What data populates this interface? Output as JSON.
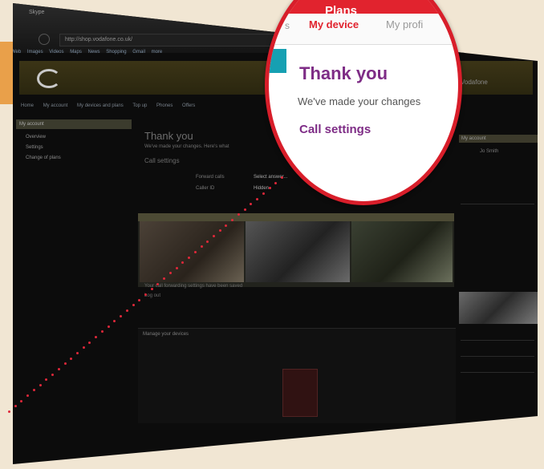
{
  "browser": {
    "title": "Skype",
    "url": "http://shop.vodafone.co.uk/",
    "menu": [
      "Web",
      "Images",
      "Videos",
      "Maps",
      "News",
      "Shopping",
      "Gmail",
      "more"
    ]
  },
  "site": {
    "header_right": "Vodafone",
    "subnav": [
      "Home",
      "My account",
      "My devices and plans",
      "Top up",
      "Phones",
      "Offers"
    ]
  },
  "sidebar": {
    "title": "My account",
    "items": [
      "Overview",
      "Settings",
      "Change of plans"
    ]
  },
  "main": {
    "title": "Thank you",
    "subtitle": "We've made your changes. Here's what",
    "section": "Call settings",
    "rows": [
      {
        "label": "Forward calls",
        "value": "Select answer..."
      },
      {
        "label": "Caller ID",
        "value": "Hidden"
      }
    ],
    "caption": "Your call forwarding settings have been saved",
    "link": "Log out",
    "panel_title": "Manage your devices"
  },
  "rightcol": {
    "title": "My account",
    "username": "Jo Smith"
  },
  "magnifier": {
    "tab_plans": "Plans",
    "tab_partial": "s",
    "tab_my_device": "My device",
    "tab_my_profile": "My profi",
    "title": "Thank you",
    "subtitle": "We've made your changes",
    "section": "Call settings"
  },
  "colors": {
    "accent_red": "#e1232e",
    "heading_purple": "#7e2c86",
    "teal": "#16a0b2"
  }
}
